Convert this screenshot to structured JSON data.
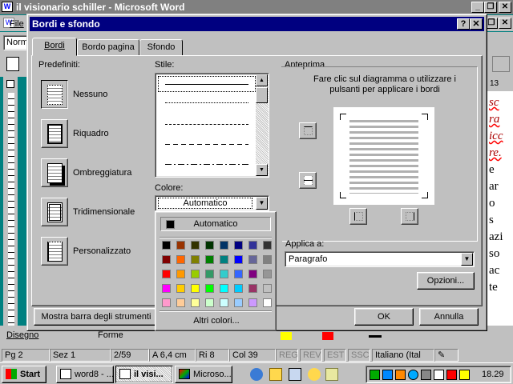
{
  "window": {
    "title": "il visionario schiller - Microsoft Word"
  },
  "menubar": {
    "first_item": "File"
  },
  "toolbar": {
    "style_value": "Norm"
  },
  "bottom_toolbar": {
    "drawing": "Disegno",
    "shapes": "Forme"
  },
  "dialog": {
    "title": "Bordi e sfondo",
    "tabs": [
      {
        "label": "Bordi"
      },
      {
        "label": "Bordo pagina"
      },
      {
        "label": "Sfondo"
      }
    ],
    "presets_label": "Predefiniti:",
    "presets": [
      {
        "label": "Nessuno"
      },
      {
        "label": "Riquadro"
      },
      {
        "label": "Ombreggiatura"
      },
      {
        "label": "Tridimensionale"
      },
      {
        "label": "Personalizzato"
      }
    ],
    "style_label": "Stile:",
    "color_label": "Colore:",
    "color_value": "Automatico",
    "preview_label": "Anteprima",
    "preview_hint": "Fare clic sul diagramma o utilizzare i pulsanti per applicare i bordi",
    "apply_label": "Applica a:",
    "apply_value": "Paragrafo",
    "options_button": "Opzioni...",
    "toolbar_button": "Mostra barra degli strumenti",
    "ok_button": "OK",
    "cancel_button": "Annulla",
    "help_button": "?",
    "close_button": "✕"
  },
  "color_popup": {
    "automatic": "Automatico",
    "more_colors": "Altri colori...",
    "colors": [
      [
        "#000000",
        "#993300",
        "#333300",
        "#003300",
        "#003366",
        "#000080",
        "#333399",
        "#333333"
      ],
      [
        "#800000",
        "#ff6600",
        "#808000",
        "#008000",
        "#008080",
        "#0000ff",
        "#666699",
        "#808080"
      ],
      [
        "#ff0000",
        "#ff9900",
        "#99cc00",
        "#339966",
        "#33cccc",
        "#3366ff",
        "#800080",
        "#969696"
      ],
      [
        "#ff00ff",
        "#ffcc00",
        "#ffff00",
        "#00ff00",
        "#00ffff",
        "#00ccff",
        "#993366",
        "#c0c0c0"
      ],
      [
        "#ff99cc",
        "#ffcc99",
        "#ffff99",
        "#ccffcc",
        "#ccffff",
        "#99ccff",
        "#cc99ff",
        "#ffffff"
      ]
    ]
  },
  "document_text": {
    "ruler_num": "13",
    "lines": [
      "sc",
      "ra",
      "icc",
      "re.",
      "e",
      "ar",
      "o",
      "s",
      "azi",
      "so",
      "ac",
      "te"
    ]
  },
  "statusbar": {
    "page": "Pg 2",
    "section": "Sez 1",
    "pages": "2/59",
    "at": "A 6,4 cm",
    "line": "Ri 8",
    "col": "Col 39",
    "reg": "REG",
    "rev": "REV",
    "est": "EST",
    "ssc": "SSC",
    "language": "Italiano (Ital"
  },
  "taskbar": {
    "start": "Start",
    "tasks": [
      {
        "label": "word8 - ..."
      },
      {
        "label": "il visi..."
      },
      {
        "label": "Microso..."
      }
    ],
    "clock": "18.29"
  }
}
